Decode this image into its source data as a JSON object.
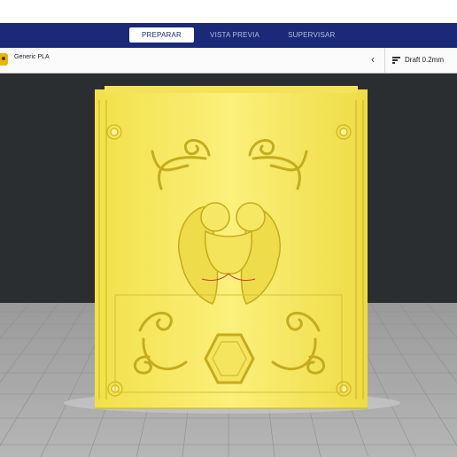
{
  "header": {
    "tabs": [
      {
        "label": "PREPARAR",
        "active": true
      },
      {
        "label": "VISTA PREVIA",
        "active": false
      },
      {
        "label": "SUPERVISAR",
        "active": false
      }
    ]
  },
  "toolbar": {
    "material_label": "Generic PLA",
    "profile_label": "Draft 0.2mm",
    "collapse_icon": "chevron-left-icon"
  },
  "colors": {
    "header_bg": "#1a2a78",
    "viewport_bg": "#2b2e31",
    "build_plate": "#a8a8a8",
    "model": "#f7ea62",
    "material_badge": "#e8b500"
  }
}
